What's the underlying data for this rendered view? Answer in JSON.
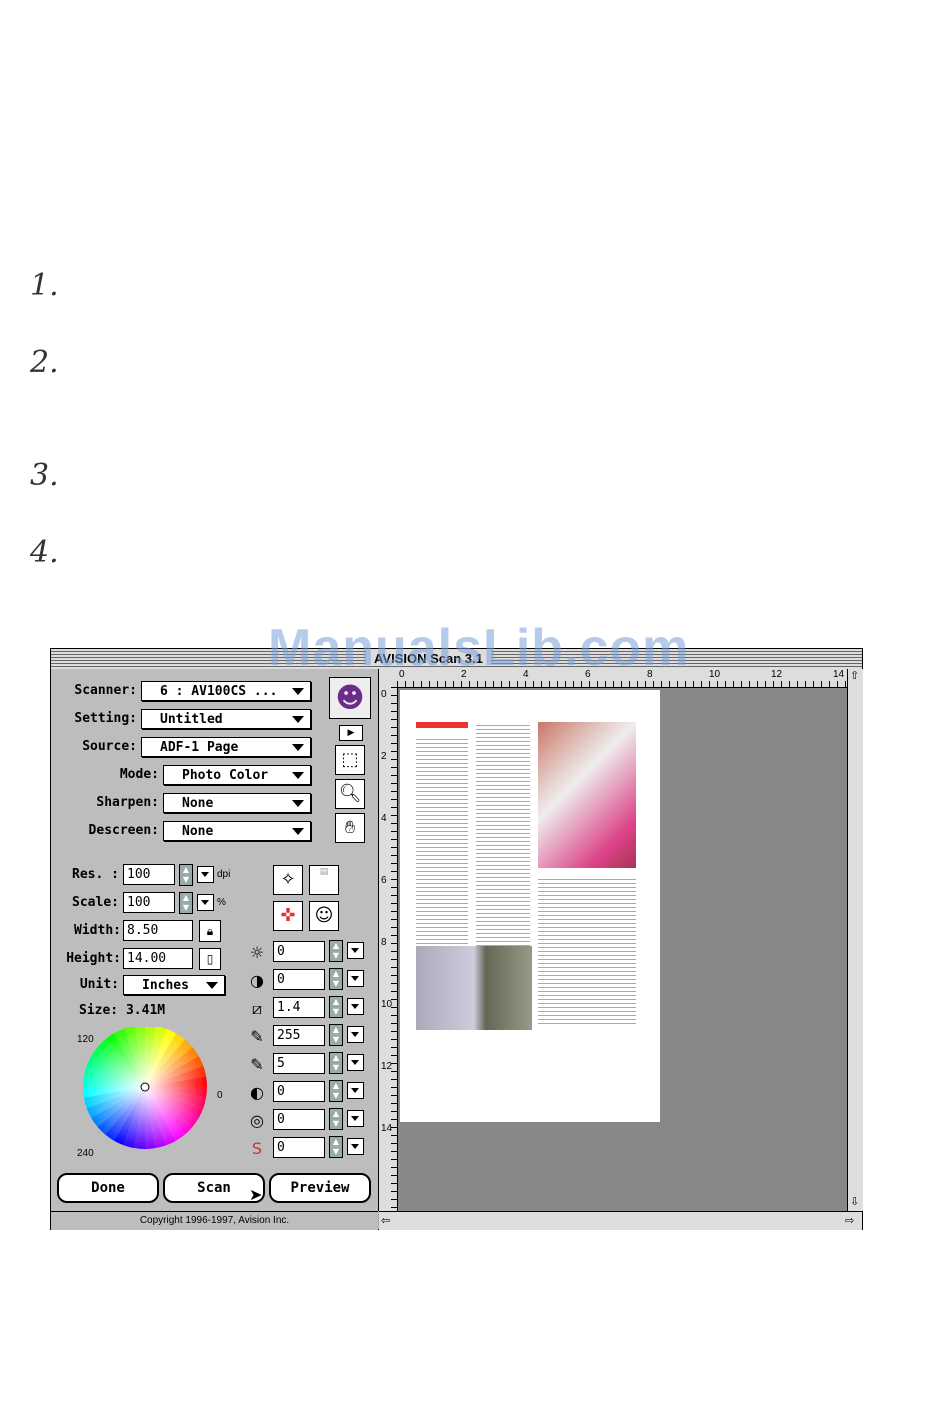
{
  "steps": [
    "1.",
    "2.",
    "3.",
    "4."
  ],
  "watermark": "ManualsLib.com",
  "window": {
    "title": "AVISION Scan 3.1"
  },
  "settings": {
    "scanner_label": "Scanner:",
    "scanner_value": "6 : AV100CS",
    "setting_label": "Setting:",
    "setting_value": "Untitled",
    "source_label": "Source:",
    "source_value": "ADF-1 Page",
    "mode_label": "Mode:",
    "mode_value": "Photo Color",
    "sharpen_label": "Sharpen:",
    "sharpen_value": "None",
    "descreen_label": "Descreen:",
    "descreen_value": "None"
  },
  "dims": {
    "res_label": "Res. :",
    "res_value": "100",
    "res_unit": "dpi",
    "scale_label": "Scale:",
    "scale_value": "100",
    "scale_unit": "%",
    "width_label": "Width:",
    "width_value": "8.50",
    "height_label": "Height:",
    "height_value": "14.00",
    "unit_label": "Unit:",
    "unit_value": "Inches",
    "size_text": "Size: 3.41M"
  },
  "color_wheel": {
    "label_120": "120",
    "label_0": "0",
    "label_240": "240"
  },
  "adjust_values": [
    "0",
    "0",
    "1.4",
    "255",
    "5",
    "0",
    "0",
    "0"
  ],
  "buttons": {
    "done": "Done",
    "scan": "Scan",
    "preview": "Preview"
  },
  "copyright": "Copyright 1996-1997, Avision Inc.",
  "ruler": {
    "top": [
      "0",
      "2",
      "4",
      "6",
      "8",
      "10",
      "12",
      "14"
    ],
    "left": [
      "0",
      "2",
      "4",
      "6",
      "8",
      "10",
      "12",
      "14"
    ]
  }
}
